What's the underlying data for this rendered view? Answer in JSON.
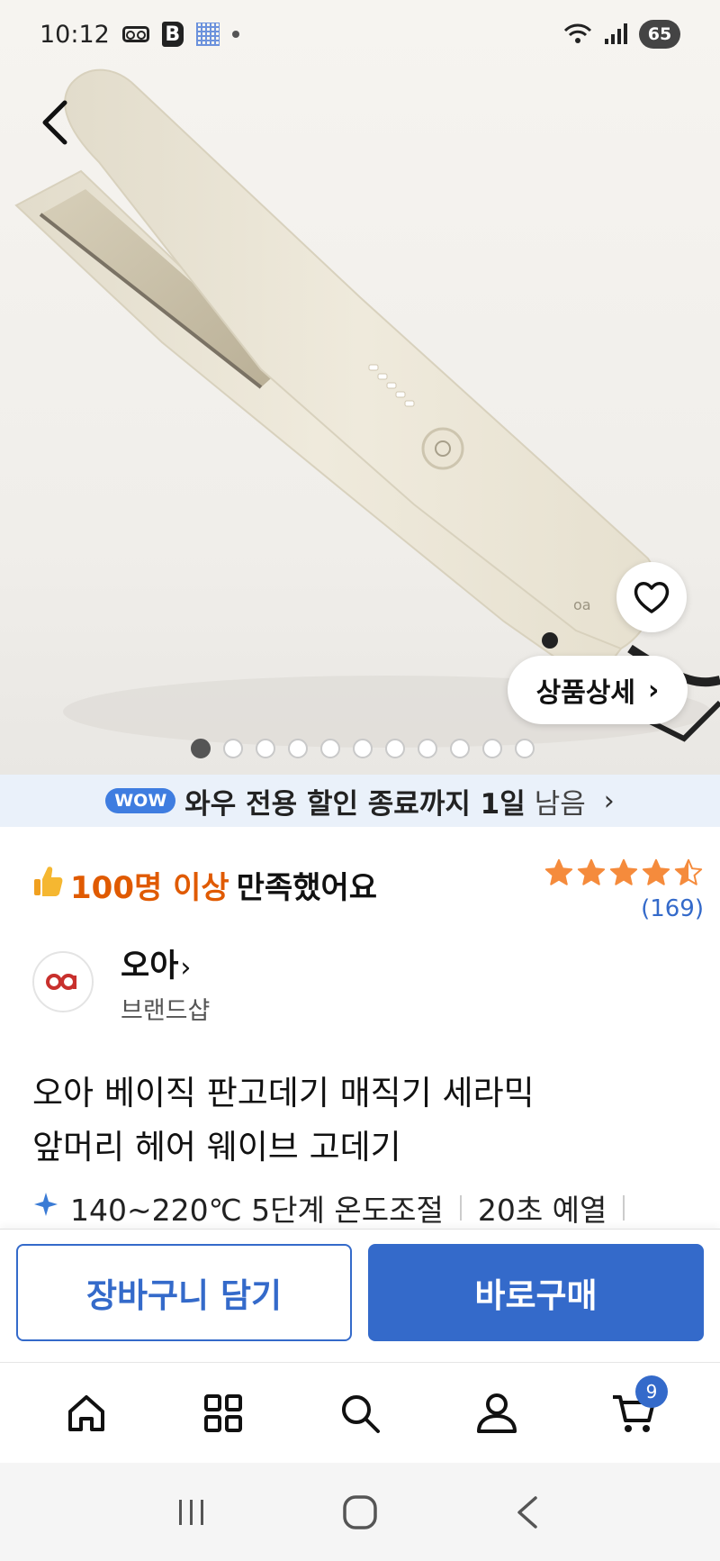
{
  "status_bar": {
    "time": "10:12",
    "battery": "65",
    "b_icon": "B"
  },
  "hero": {
    "active_image_index": 0,
    "image_count": 11,
    "detail_button_label": "상품상세",
    "detail_arrow": "›",
    "brand_mark": "oa"
  },
  "wow_banner": {
    "badge": "WOW",
    "text": "와우 전용 할인 종료까지 1일",
    "remain": "남음",
    "chevron": "›"
  },
  "satisfaction": {
    "count_text": "100명 이상",
    "suffix_text": "만족했어요"
  },
  "rating": {
    "stars": 4.5,
    "review_count": "(169)",
    "star_color": "#f58b3c"
  },
  "brand": {
    "logo_text": "oa",
    "name": "오아",
    "arrow": "›",
    "subtitle": "브랜드샵"
  },
  "product": {
    "title_line1": "오아 베이직 판고데기 매직기 세라믹",
    "title_line2": "앞머리 헤어 웨이브 고데기",
    "features": [
      "140~220℃ 5단계 온도조절",
      "20초 예열"
    ]
  },
  "cta": {
    "cart_label": "장바구니 담기",
    "buy_label": "바로구매",
    "accent_color": "#346aca"
  },
  "bottom_nav": {
    "items": [
      "home-icon",
      "category-grid-icon",
      "search-icon",
      "profile-icon",
      "cart-icon"
    ],
    "cart_badge": "9"
  },
  "system_nav": {
    "items": [
      "recents-icon",
      "home-icon",
      "back-icon"
    ]
  }
}
